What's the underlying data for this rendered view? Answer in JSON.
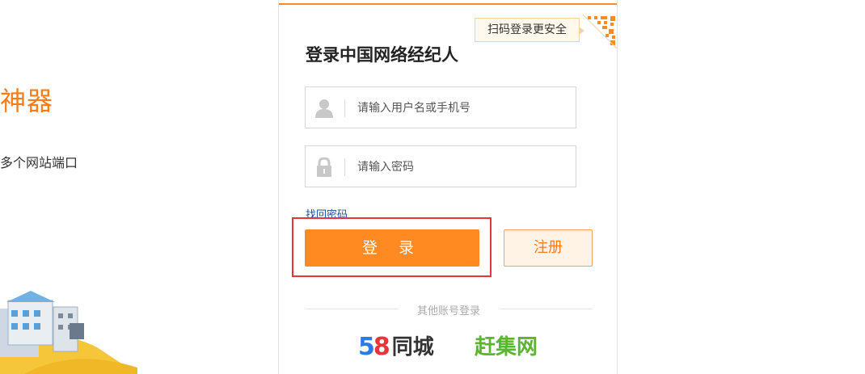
{
  "promo": {
    "title": "神器",
    "subtitle": "多个网站端口"
  },
  "login": {
    "qr_tip": "扫码登录更安全",
    "title": "登录中国网络经纪人",
    "username_placeholder": "请输入用户名或手机号",
    "password_placeholder": "请输入密码",
    "forgot_password": "找回密码",
    "login_button": "登 录",
    "register_button": "注册",
    "other_accounts": "其他账号登录",
    "partner_58_num5": "5",
    "partner_58_num8": "8",
    "partner_58_text": "同城",
    "partner_ganji": "赶集网"
  },
  "colors": {
    "accent": "#ff8a22",
    "highlight": "#e8353b",
    "link": "#1f4fa0",
    "ganji_green": "#5cb531",
    "brand_58_blue": "#2c7be5"
  }
}
